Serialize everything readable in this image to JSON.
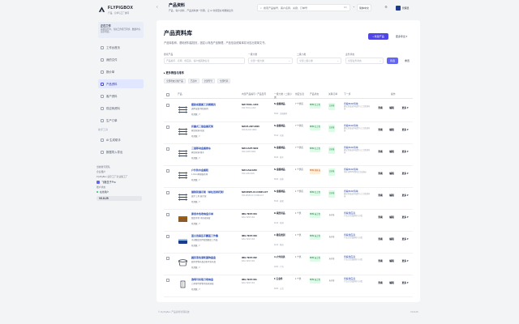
{
  "brand": {
    "name": "FLYPIGBOX",
    "subtitle": "产品、订单与工厂协同"
  },
  "notice": {
    "title": "正在工作",
    "text": "系统运行中，当前工作区已同步，数据均为演示用途。"
  },
  "sidebar": {
    "items": [
      {
        "label": "工作台首页",
        "icon": "home-icon",
        "active": false
      },
      {
        "label": "我的文件",
        "icon": "folder-icon",
        "active": false
      },
      {
        "label": "报价单",
        "icon": "quote-icon",
        "active": false
      },
      {
        "label": "产品资料",
        "icon": "box-icon",
        "active": true
      },
      {
        "label": "客户资料",
        "icon": "users-icon",
        "active": false
      },
      {
        "label": "供应商资料",
        "icon": "factory-icon",
        "active": false
      },
      {
        "label": "生产订单",
        "icon": "order-icon",
        "active": false
      }
    ],
    "section_label": "助手工具",
    "tools": [
      {
        "label": "AI 生成助手",
        "icon": "sparkle-icon"
      },
      {
        "label": "数据导入导出",
        "icon": "transfer-icon"
      }
    ]
  },
  "user": {
    "heading": "当前账号团队",
    "role": "企业租户",
    "org": "FlyPigBox 演示工厂企业版工厂",
    "tenant": "飞猪盒子Pro",
    "status_label": "账户状态",
    "online": "在线用户",
    "version": "V0.8.25"
  },
  "header": {
    "title": "产品资料",
    "crumb": "产品、客户资料、产品资料统一管理，让 AI 也能更好地理解业务",
    "search_placeholder": "搜索产品编号、客户名称、关键、订单号",
    "search_key": "⌘K",
    "lang": "简体中文",
    "user": "管理员"
  },
  "page": {
    "title": "产品资料库",
    "description": "产品库各种、基础资料建档页，固定以商品产品管理，产品信息统筹库存对应出现库文书。",
    "new_button": "+ 新建产品",
    "more_button": "更多导出 ▾",
    "filters": [
      {
        "label": "搜索产品",
        "placeholder": "产品编号、名称、供应商、客户或其他信息"
      },
      {
        "label": "一级大类",
        "placeholder": "全部一级大类"
      },
      {
        "label": "二级小类",
        "placeholder": "全部二级小类"
      },
      {
        "label": "业务状态",
        "placeholder": "全部业务状态"
      }
    ],
    "search_button": "筛选",
    "reset_button": "重置",
    "more_filters": "▸ 更多筛选与排序",
    "chips": [
      "全部状态分类产品",
      "已选中",
      "全部型号",
      "全部代码"
    ]
  },
  "table": {
    "headers": [
      "产品",
      "内部产品编号 / 产品型号",
      "一级大类 / 二级小类",
      "供应信息",
      "产品状态",
      "关联订单",
      "下一步",
      "操作"
    ],
    "actions": [
      "查看",
      "编辑",
      "更多 ▾"
    ],
    "rows": [
      {
        "name": "塑胶成套属工具刷刷具",
        "sub": "通用成套•塑胶刷具",
        "rel": "已关联 ↗",
        "code": "NW-TOOL-1200",
        "code_sub": "NW-TOOL-1200",
        "cat": "N-金属制品",
        "cat_sub": "5600 · 金属刷具",
        "supplier": "7 个供应",
        "status": "BOM 已上传",
        "status_color": "green",
        "status_note": "",
        "sync": "已对接",
        "sync_color": "green",
        "next": "查看BOM清单",
        "next_sub": "建议复核成本核算与工艺路线内容",
        "thumb": "rack"
      },
      {
        "name": "折叠式三层金属花架",
        "sub": "家居收纳•花架",
        "rel": "已关联 ↗",
        "code": "NW-PLANT-0800",
        "code_sub": "NW-PLANT-0800",
        "cat": "N-金属制品",
        "cat_sub": "5610 · 花架",
        "supplier": "7 个供应",
        "status": "BOM 已上传",
        "status_color": "green",
        "status_note": "",
        "sync": "已对接",
        "sync_color": "green",
        "next": "查看BOM清单",
        "next_sub": "建议复核成本核算与工艺路线内容",
        "thumb": "rack"
      },
      {
        "name": "三层移动金属推车",
        "sub": "家居收纳•推车",
        "rel": "已关联 ↗",
        "code": "NW-CART-0900",
        "code_sub": "NW-CART-0900",
        "cat": "N-金属制品",
        "cat_sub": "5620 · 推车",
        "supplier": "7 个供应",
        "status": "BOM 已上传",
        "status_color": "green",
        "status_note": "",
        "sync": "已对接",
        "sync_color": "green",
        "next": "查看BOM清单",
        "next_sub": "建议复核成本核算与工艺路线内容",
        "thumb": "rack"
      },
      {
        "name": "户外防水金属柜",
        "sub": "1.0mm厚钢板柜体",
        "rel": "已关联 ↗",
        "code": "NW-CAB-0220",
        "code_sub": "NW-CAB-0220",
        "cat": "N-金属制品",
        "cat_sub": "5630 · 柜体",
        "supplier": "1 个供应",
        "status": "BOM 待补充",
        "status_color": "orange",
        "status_note": "",
        "sync": "已对接",
        "sync_color": "green",
        "next": "查看BOM清单",
        "next_sub": "待补充BOM资料后生成报价",
        "thumb": "rack"
      },
      {
        "name": "展架和展示架（单柱双排托架）",
        "sub": "展示工具·展示架",
        "rel": "已关联 ↗",
        "code": "NW-DISPLAY-CONFLICT",
        "code_sub": "NW-DISPLAY-CONFLICT",
        "cat": "N-金属制品",
        "cat_sub": "5640 · 展架",
        "supplier": "1 个供应",
        "status": "BOM 已上传",
        "status_color": "green",
        "status_note": "",
        "sync": "已对接",
        "sync_color": "green",
        "next": "查看BOM清单",
        "next_sub": "建议复核成本核算与工艺路线内容",
        "thumb": "rack"
      },
      {
        "name": "原创木色收纳盒示单",
        "sub": "图案木材·木色收纳盒",
        "rel": "已关联 ↗",
        "code": "IMG-TEST-064",
        "code_sub": "IMG-TEST-064",
        "cat": "B-家居用品",
        "cat_sub": "3120 · 收纳",
        "supplier": "1 个供",
        "status": "BOM 未上传",
        "status_color": "green",
        "status_note": "",
        "sync": "未对接",
        "sync_color": "gray",
        "next": "查看供应商",
        "next_sub": "产品已完成建档与分类",
        "thumb": "box"
      },
      {
        "name": "蓝白双扁压手翻盖工作集",
        "sub": "手动翻盖组件双面翻盖工作集",
        "rel": "已关联 ↗",
        "code": "IMG-TEST-063",
        "code_sub": "IMG-TEST-063",
        "cat": "C-箱包类别",
        "cat_sub": "4100 · 箱包",
        "supplier": "1 个供",
        "status": "BOM 未上传",
        "status_color": "green",
        "status_note": "",
        "sync": "未对接",
        "sync_color": "gray",
        "next": "查看供应商",
        "next_sub": "产品已完成建档与分类",
        "thumb": "bag"
      },
      {
        "name": "圆形黑色滚轮置物面盘",
        "sub": "圆木置物托盘边框木色托盘",
        "rel": "已关联 ↗",
        "code": "IMG-TEST-062",
        "code_sub": "IMG-TEST-062",
        "cat": "A-户外用具",
        "cat_sub": "2200 · 户外",
        "supplier": "1 个供",
        "status": "BOM 未上传",
        "status_color": "green",
        "status_note": "",
        "sync": "未对接",
        "sync_color": "gray",
        "next": "查看供应商",
        "next_sub": "产品已完成建档与分类",
        "thumb": "basket"
      },
      {
        "name": "透明可拆取刀收纳盒",
        "sub": "刀具零件置物木质收纳盒",
        "rel": "已关联 ↗",
        "code": "IMG-TEST-061",
        "code_sub": "IMG-TEST-061",
        "cat": "F-五金件",
        "cat_sub": "6200 · 五金",
        "supplier": "1 个供",
        "status": "BOM 未上传",
        "status_color": "green",
        "status_note": "",
        "sync": "未对接",
        "sync_color": "gray",
        "next": "查看供应商",
        "next_sub": "产品已完成建档与分类",
        "thumb": "tool"
      }
    ]
  },
  "footer": {
    "left": "© FlyPigBox 产品资料管理系统",
    "right": "V0.8.25"
  },
  "colors": {
    "accent": "#4f46e5",
    "link": "#1e40af",
    "ok": "#166534",
    "warn": "#c2410c"
  }
}
